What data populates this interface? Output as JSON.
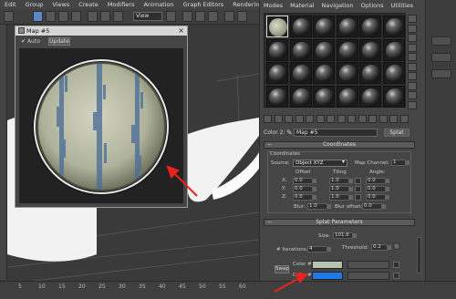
{
  "main_menu": [
    "Edit",
    "Group",
    "Views",
    "Create",
    "Modifiers",
    "Animation",
    "Graph Editors",
    "Rendering",
    "Cu"
  ],
  "toolbar": {
    "view_dropdown": "View"
  },
  "map_window": {
    "title": "Map #5",
    "close_glyph": "×",
    "auto_label": "Auto",
    "auto_checked": true,
    "update_button": "Update"
  },
  "material_editor": {
    "menu": [
      "Modes",
      "Material",
      "Navigation",
      "Options",
      "Utilities"
    ],
    "color_label": "Color 2:",
    "map_name": "Map #5",
    "map_type": "Splat",
    "coordinates": {
      "rollout_title": "Coordinates",
      "group_label": "Coordinates",
      "source_label": "Source:",
      "source_value": "Object XYZ",
      "map_channel_label": "Map Channel:",
      "map_channel_value": "1",
      "offset_header": "Offset",
      "tiling_header": "Tiling",
      "angle_header": "Angle:",
      "axes": [
        "X:",
        "Y:",
        "Z:"
      ],
      "offset": [
        "0.0",
        "0.0",
        "0.0"
      ],
      "tiling": [
        "1.0",
        "1.0",
        "1.0"
      ],
      "angle": [
        "0.0",
        "0.0",
        "0.0"
      ],
      "blur_label": "Blur:",
      "blur_value": "1.0",
      "blur_offset_label": "Blur offset:",
      "blur_offset_value": "0.0"
    },
    "splat": {
      "rollout_title": "Splat Parameters",
      "size_label": "Size:",
      "size_value": "101.6",
      "iterations_label": "# Iterations:",
      "iterations_value": "4",
      "threshold_label": "Threshold:",
      "threshold_value": "0.2",
      "swap_label": "Swap",
      "color1_label": "Color #1",
      "color2_label": "Color #2",
      "color1": "#b6c4b2",
      "color2": "#1f78e8"
    }
  },
  "timeline": {
    "ticks": [
      "5",
      "10",
      "15",
      "20",
      "25",
      "30",
      "35",
      "40",
      "45",
      "50",
      "55",
      "60"
    ]
  },
  "annotation_color": "#e8231c"
}
